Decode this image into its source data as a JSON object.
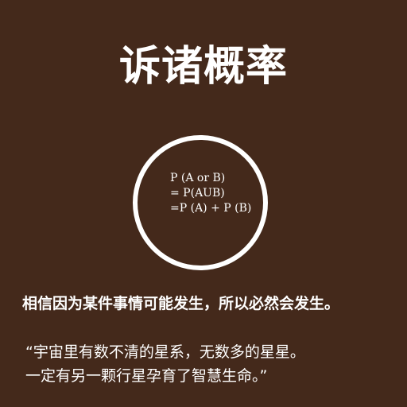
{
  "title": "诉诸概率",
  "formula": {
    "line1": "P (A or B)",
    "line2": "= P(AUB)",
    "line3": "=P (A) + P (B)"
  },
  "statement": "相信因为某件事情可能发生，所以必然会发生。",
  "quote": {
    "line1": "“宇宙里有数不清的星系，无数多的星星。",
    "line2": "一定有另一颗行星孕育了智慧生命。”"
  }
}
